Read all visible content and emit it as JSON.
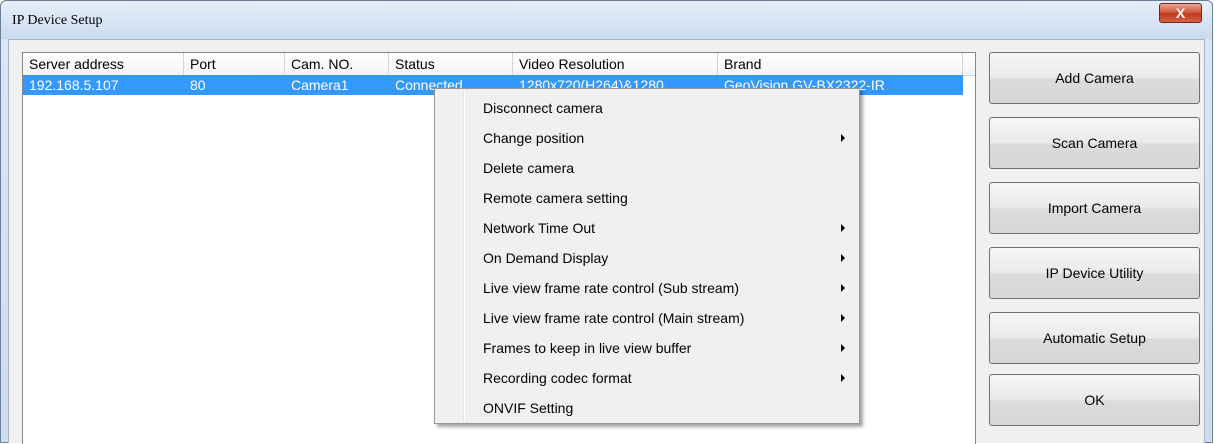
{
  "window": {
    "title": "IP Device Setup",
    "close_label": "X"
  },
  "columns": [
    "Server address",
    "Port",
    "Cam. NO.",
    "Status",
    "Video Resolution",
    "Brand"
  ],
  "rows": [
    {
      "server": "192.168.5.107",
      "port": "80",
      "cam": "Camera1",
      "status": "Connected",
      "resolution": "1280x720(H264)&1280",
      "brand": "GeoVision GV-BX2322-IR"
    }
  ],
  "buttons": {
    "add": "Add Camera",
    "scan": "Scan Camera",
    "import": "Import Camera",
    "utility": "IP Device Utility",
    "auto": "Automatic Setup",
    "ok": "OK"
  },
  "context_menu": {
    "items": [
      {
        "label": "Disconnect camera",
        "submenu": false
      },
      {
        "label": "Change position",
        "submenu": true
      },
      {
        "label": "Delete camera",
        "submenu": false
      },
      {
        "label": "Remote camera setting",
        "submenu": false
      },
      {
        "label": "Network Time Out",
        "submenu": true
      },
      {
        "label": "On Demand Display",
        "submenu": true
      },
      {
        "label": "Live view frame rate control (Sub stream)",
        "submenu": true
      },
      {
        "label": "Live view frame rate control (Main stream)",
        "submenu": true
      },
      {
        "label": "Frames to keep in live view buffer",
        "submenu": true
      },
      {
        "label": "Recording codec format",
        "submenu": true
      },
      {
        "label": "ONVIF Setting",
        "submenu": false
      }
    ]
  },
  "colors": {
    "selection": "#3399ff",
    "menu_bg": "#f0f0f0"
  }
}
